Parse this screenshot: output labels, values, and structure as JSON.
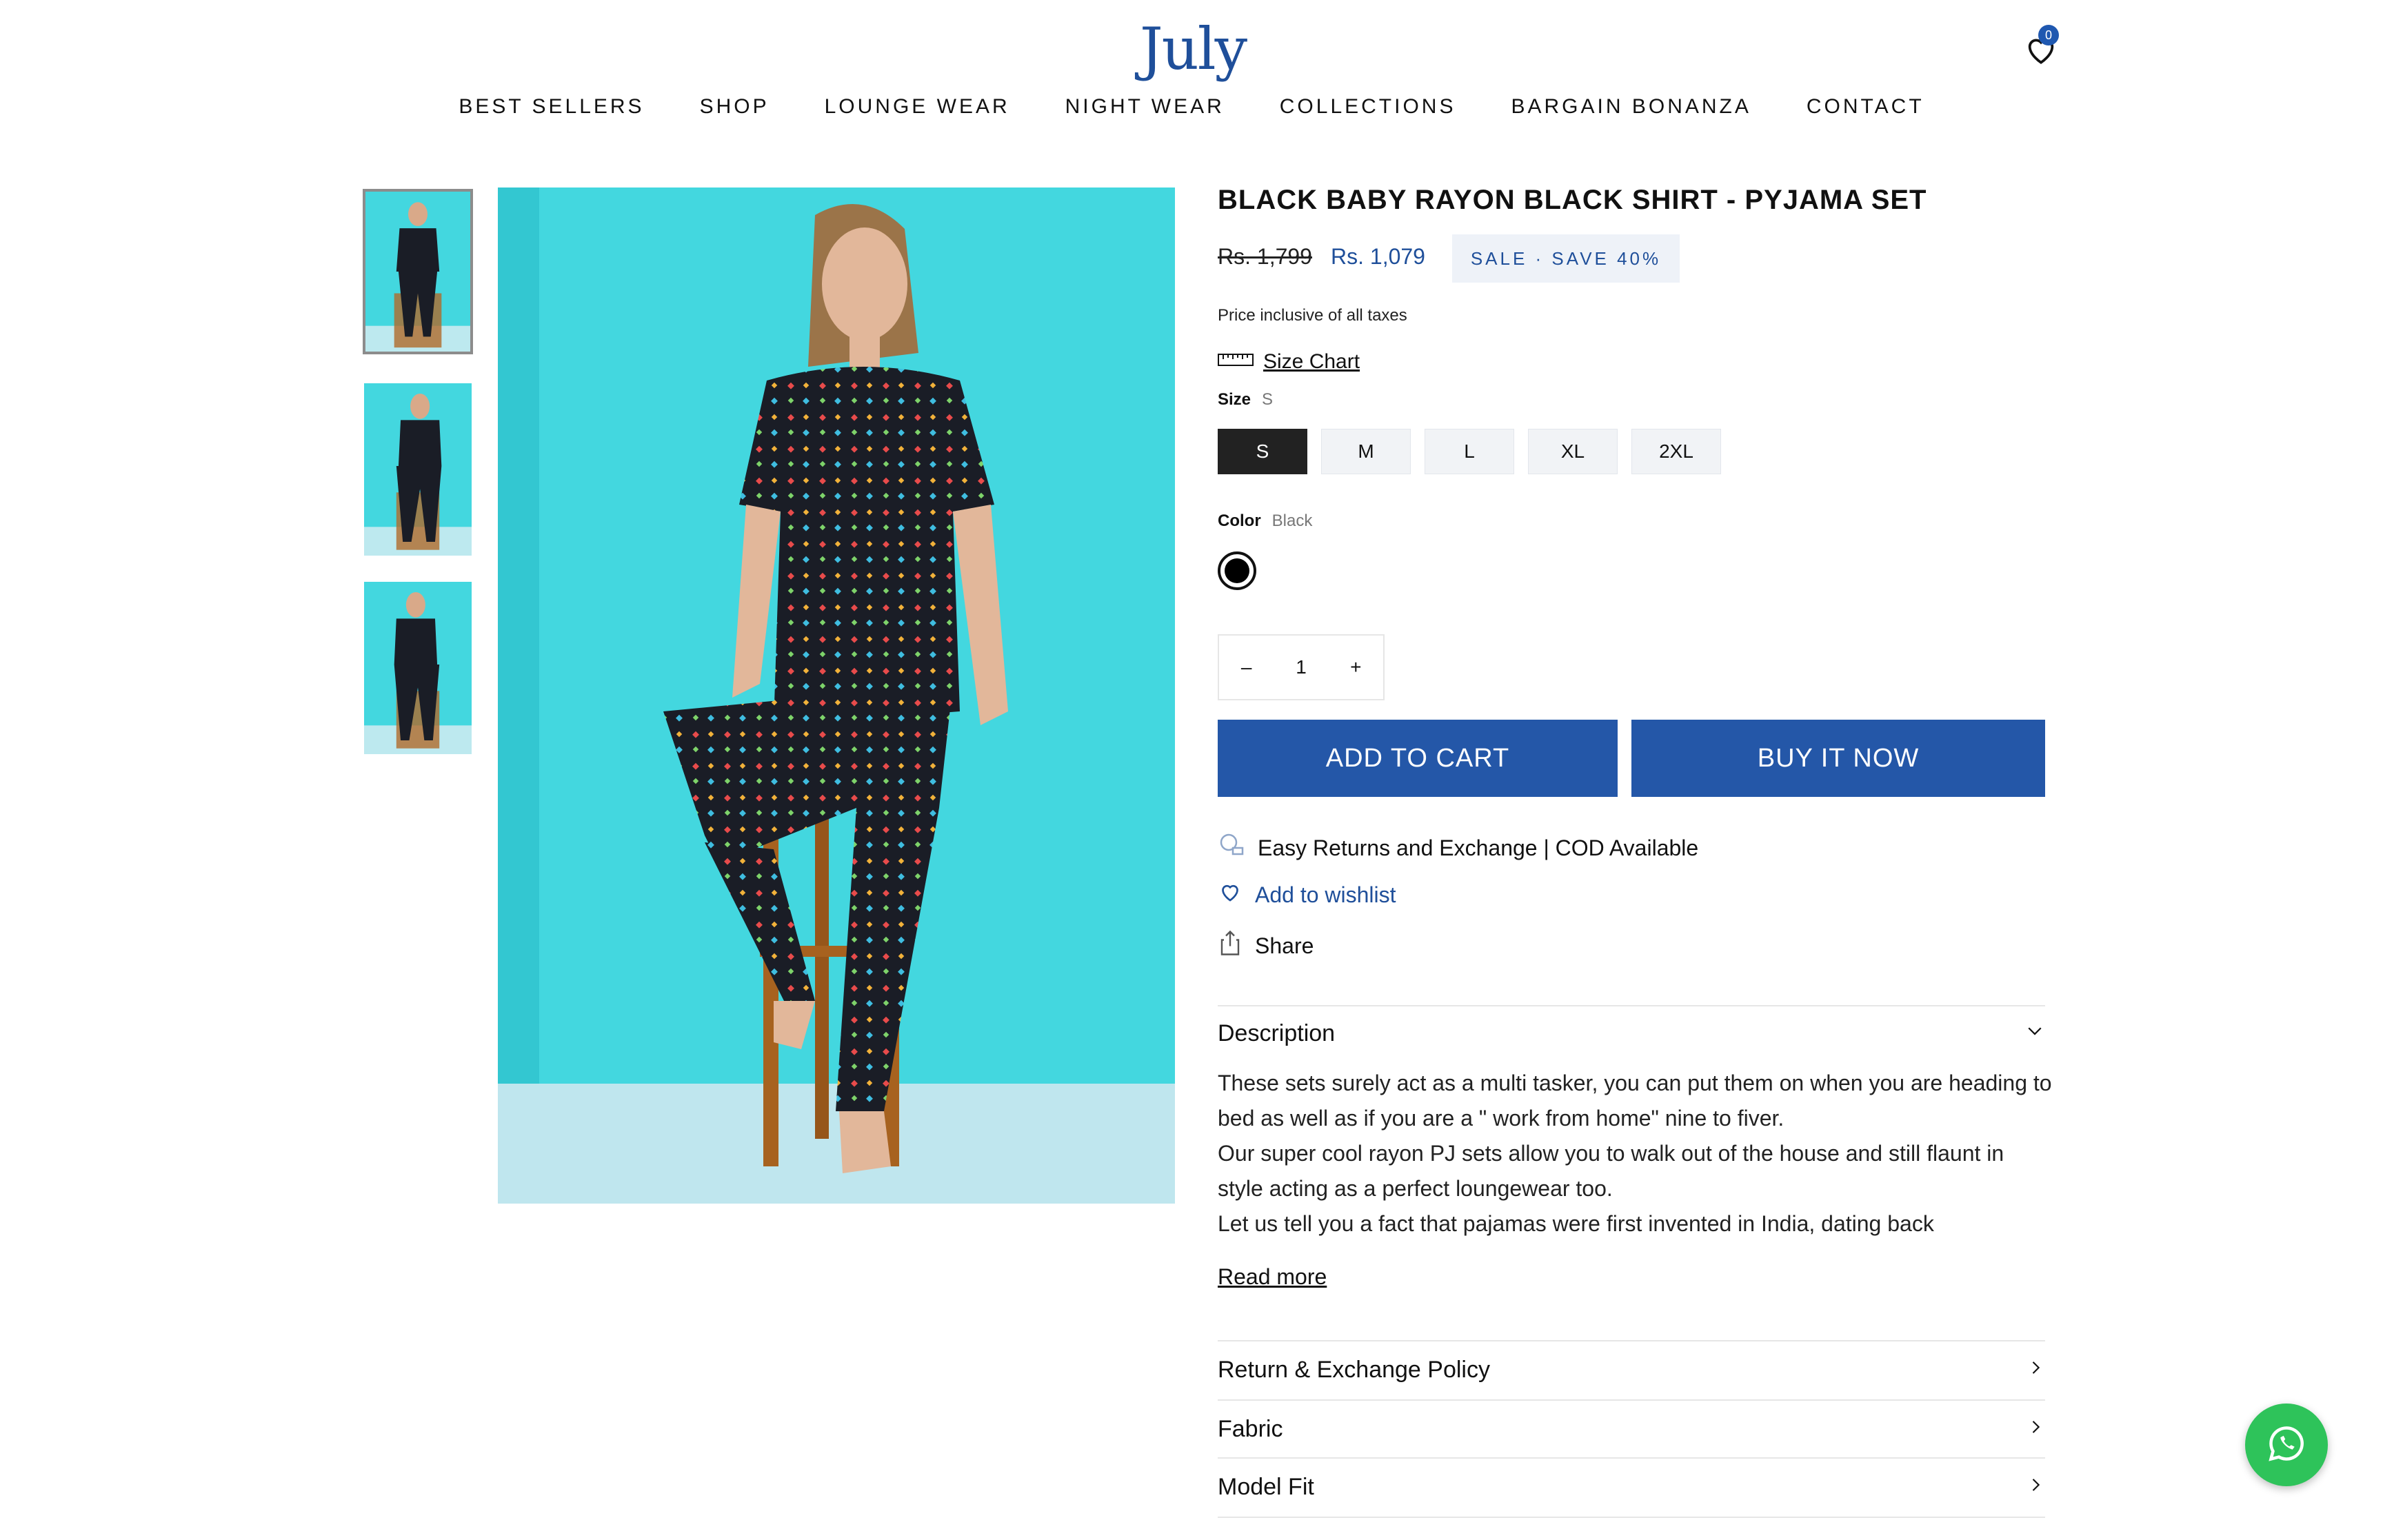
{
  "header": {
    "logo": "July",
    "wishlist_count": "0",
    "nav": [
      "BEST SELLERS",
      "SHOP",
      "LOUNGE WEAR",
      "NIGHT WEAR",
      "COLLECTIONS",
      "BARGAIN BONANZA",
      "CONTACT"
    ]
  },
  "product": {
    "title": "BLACK BABY RAYON BLACK SHIRT - PYJAMA SET",
    "price_compare": "Rs. 1,799",
    "price": "Rs. 1,079",
    "sale_badge": "SALE · SAVE 40%",
    "tax_note": "Price inclusive of all taxes",
    "size_chart_label": "Size Chart",
    "size_label": "Size",
    "size_selected": "S",
    "sizes": [
      "S",
      "M",
      "L",
      "XL",
      "2XL"
    ],
    "color_label": "Color",
    "color_selected": "Black",
    "swatch_color": "#000000",
    "quantity": {
      "minus": "–",
      "value": "1",
      "plus": "+"
    },
    "add_to_cart": "ADD TO CART",
    "buy_now": "BUY IT NOW",
    "returns_note": "Easy Returns and Exchange | COD Available",
    "wishlist": "Add to wishlist",
    "share": "Share"
  },
  "description": {
    "heading": "Description",
    "paragraphs": [
      "These sets surely act as a multi tasker, you can put them on when you are heading to bed as well as if you are a \" work from home\" nine to fiver.",
      "Our super cool rayon PJ sets allow you to walk out of the house and still flaunt in style acting as a perfect loungewear too.",
      "Let us tell you a fact that pajamas were first invented in India, dating back"
    ],
    "read_more": "Read more"
  },
  "accordions": [
    "Return & Exchange Policy",
    "Fabric",
    "Model Fit"
  ],
  "colors": {
    "accent": "#2457a8",
    "brand": "#1f4f9a",
    "backdrop": "#43d7df",
    "whatsapp": "#2ec35a"
  }
}
